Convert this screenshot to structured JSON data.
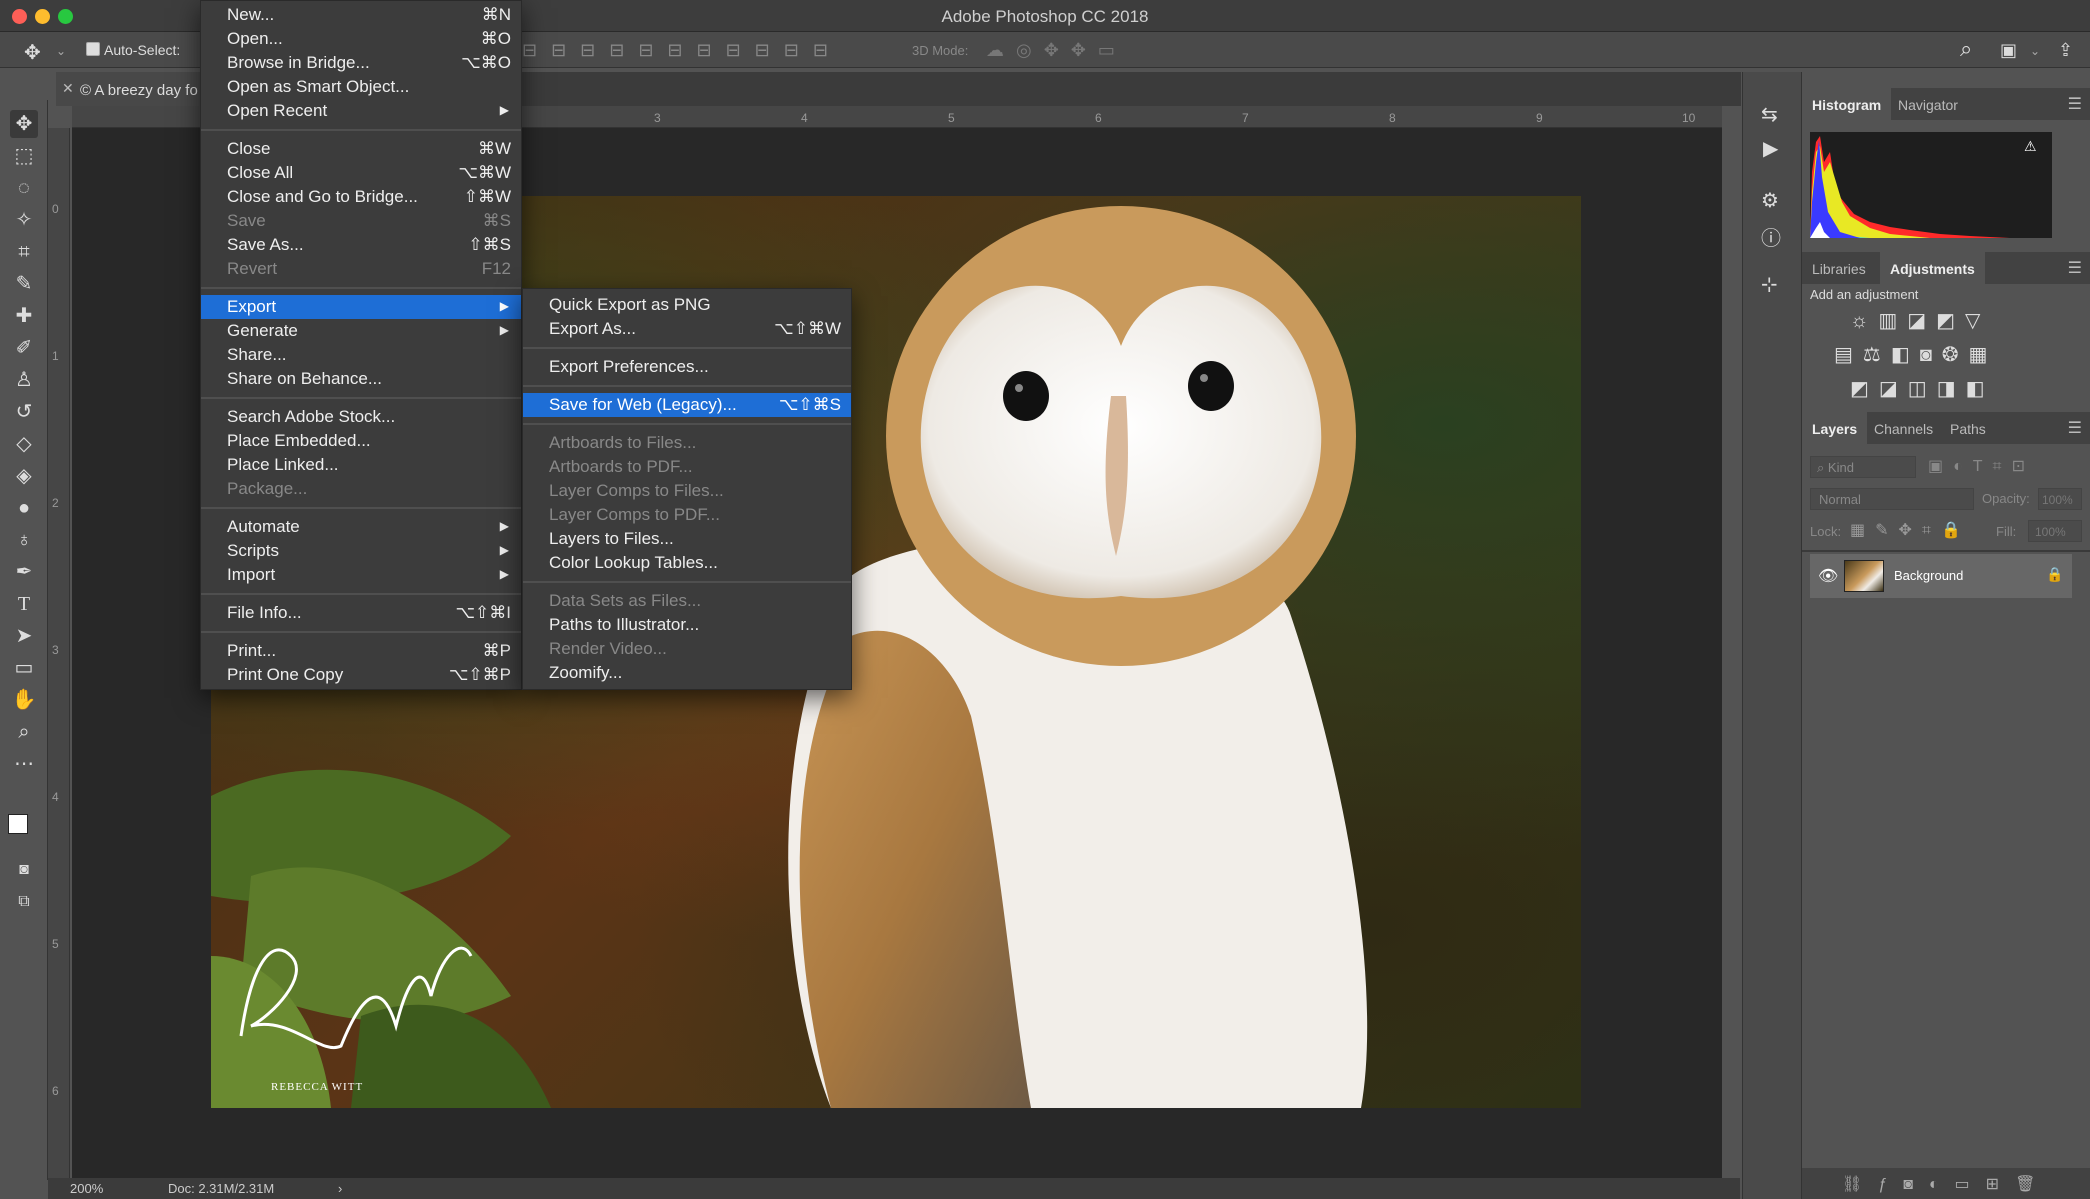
{
  "app_title": "Adobe Photoshop CC 2018",
  "options_bar": {
    "auto_select": "Auto-Select:",
    "three_d_mode": "3D Mode:"
  },
  "document_tab": "© A breezy day fo",
  "ruler_h": [
    "3",
    "4",
    "5",
    "6",
    "7",
    "8",
    "9",
    "10"
  ],
  "ruler_v": [
    "0",
    "1",
    "2",
    "3",
    "4",
    "5",
    "6"
  ],
  "status": {
    "zoom": "200%",
    "doc": "Doc: 2.31M/2.31M"
  },
  "watermark": "REBECCA WITT",
  "file_menu": [
    {
      "label": "New...",
      "shortcut": "⌘N"
    },
    {
      "label": "Open...",
      "shortcut": "⌘O"
    },
    {
      "label": "Browse in Bridge...",
      "shortcut": "⌥⌘O"
    },
    {
      "label": "Open as Smart Object...",
      "shortcut": ""
    },
    {
      "label": "Open Recent",
      "shortcut": "",
      "submenu": true
    },
    {
      "label": "Close",
      "shortcut": "⌘W"
    },
    {
      "label": "Close All",
      "shortcut": "⌥⌘W"
    },
    {
      "label": "Close and Go to Bridge...",
      "shortcut": "⇧⌘W"
    },
    {
      "label": "Save",
      "shortcut": "⌘S",
      "disabled": true
    },
    {
      "label": "Save As...",
      "shortcut": "⇧⌘S"
    },
    {
      "label": "Revert",
      "shortcut": "F12",
      "disabled": true
    },
    {
      "label": "Export",
      "shortcut": "",
      "submenu": true,
      "highlight": true
    },
    {
      "label": "Generate",
      "shortcut": "",
      "submenu": true
    },
    {
      "label": "Share...",
      "shortcut": ""
    },
    {
      "label": "Share on Behance...",
      "shortcut": ""
    },
    {
      "label": "Search Adobe Stock...",
      "shortcut": ""
    },
    {
      "label": "Place Embedded...",
      "shortcut": ""
    },
    {
      "label": "Place Linked...",
      "shortcut": ""
    },
    {
      "label": "Package...",
      "shortcut": "",
      "disabled": true
    },
    {
      "label": "Automate",
      "shortcut": "",
      "submenu": true
    },
    {
      "label": "Scripts",
      "shortcut": "",
      "submenu": true
    },
    {
      "label": "Import",
      "shortcut": "",
      "submenu": true
    },
    {
      "label": "File Info...",
      "shortcut": "⌥⇧⌘I"
    },
    {
      "label": "Print...",
      "shortcut": "⌘P"
    },
    {
      "label": "Print One Copy",
      "shortcut": "⌥⇧⌘P"
    }
  ],
  "export_menu": [
    {
      "label": "Quick Export as PNG",
      "shortcut": ""
    },
    {
      "label": "Export As...",
      "shortcut": "⌥⇧⌘W"
    },
    {
      "label": "Export Preferences...",
      "shortcut": ""
    },
    {
      "label": "Save for Web (Legacy)...",
      "shortcut": "⌥⇧⌘S",
      "highlight": true
    },
    {
      "label": "Artboards to Files...",
      "shortcut": "",
      "disabled": true
    },
    {
      "label": "Artboards to PDF...",
      "shortcut": "",
      "disabled": true
    },
    {
      "label": "Layer Comps to Files...",
      "shortcut": "",
      "disabled": true
    },
    {
      "label": "Layer Comps to PDF...",
      "shortcut": "",
      "disabled": true
    },
    {
      "label": "Layers to Files...",
      "shortcut": ""
    },
    {
      "label": "Color Lookup Tables...",
      "shortcut": ""
    },
    {
      "label": "Data Sets as Files...",
      "shortcut": "",
      "disabled": true
    },
    {
      "label": "Paths to Illustrator...",
      "shortcut": ""
    },
    {
      "label": "Render Video...",
      "shortcut": "",
      "disabled": true
    },
    {
      "label": "Zoomify...",
      "shortcut": ""
    }
  ],
  "panels": {
    "histogram_tabs": [
      "Histogram",
      "Navigator"
    ],
    "adjust_tabs": [
      "Libraries",
      "Adjustments"
    ],
    "add_adjustment": "Add an adjustment",
    "layers_tabs": [
      "Layers",
      "Channels",
      "Paths"
    ],
    "kind": "Kind",
    "blend_mode": "Normal",
    "opacity_label": "Opacity:",
    "opacity_value": "100%",
    "lock_label": "Lock:",
    "fill_label": "Fill:",
    "fill_value": "100%",
    "layer_name": "Background"
  }
}
